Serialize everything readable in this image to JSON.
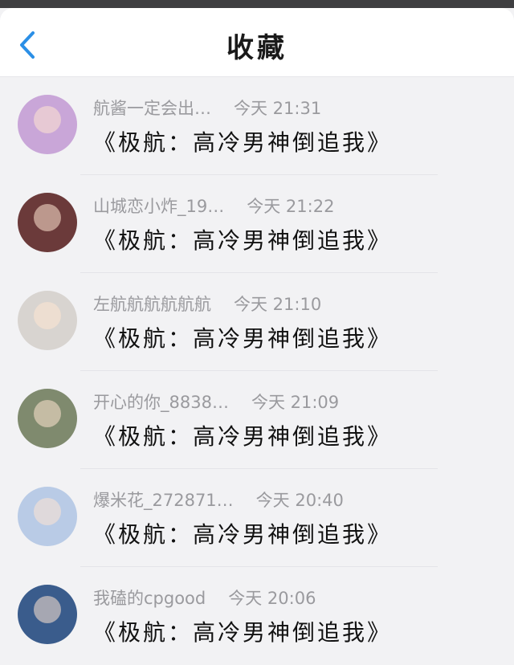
{
  "header": {
    "title": "收藏",
    "back_icon": "chevron-left-icon",
    "accent": "#2b8fe6"
  },
  "items": [
    {
      "sender": "航酱一定会出…",
      "time": "今天 21:31",
      "message": "《极航：高冷男神倒追我》",
      "avatar_color": "#c9a6d8"
    },
    {
      "sender": "山城恋小炸_19…",
      "time": "今天 21:22",
      "message": "《极航：高冷男神倒追我》",
      "avatar_color": "#6b3a3a"
    },
    {
      "sender": "左航航航航航航",
      "time": "今天 21:10",
      "message": "《极航：高冷男神倒追我》",
      "avatar_color": "#d8d4d0"
    },
    {
      "sender": "开心的你_8838…",
      "time": "今天 21:09",
      "message": "《极航：高冷男神倒追我》",
      "avatar_color": "#7f8a6e"
    },
    {
      "sender": "爆米花_272871…",
      "time": "今天 20:40",
      "message": "《极航：高冷男神倒追我》",
      "avatar_color": "#b9cbe6"
    },
    {
      "sender": "我磕的cpgood",
      "time": "今天 20:06",
      "message": "《极航：高冷男神倒追我》",
      "avatar_color": "#3a5c8c"
    }
  ]
}
